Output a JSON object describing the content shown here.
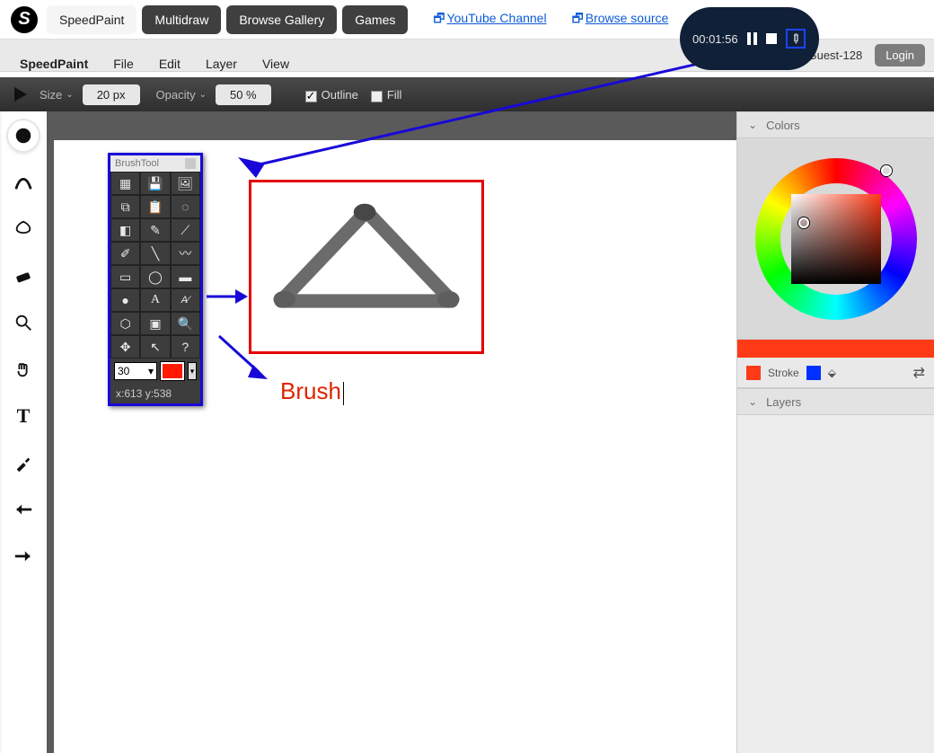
{
  "nav": {
    "logo_letter": "S",
    "tabs": [
      "SpeedPaint",
      "Multidraw",
      "Browse Gallery",
      "Games"
    ],
    "active_tab": 0,
    "links": [
      "YouTube Channel",
      "Browse source"
    ]
  },
  "recorder": {
    "time": "00:01:56"
  },
  "greet": {
    "hello": "Hi Guest-128",
    "login": "Login"
  },
  "menu": {
    "title": "SpeedPaint",
    "items": [
      "File",
      "Edit",
      "Layer",
      "View"
    ]
  },
  "options": {
    "size_label": "Size",
    "size_value": "20 px",
    "opacity_label": "Opacity",
    "opacity_value": "50 %",
    "outline_label": "Outline",
    "outline_checked": true,
    "fill_label": "Fill",
    "fill_checked": false
  },
  "left_tools": [
    "brush",
    "smudge",
    "liquify",
    "eraser",
    "zoom",
    "pan",
    "text",
    "eyedropper",
    "undo",
    "redo"
  ],
  "brushpanel": {
    "title": "BrushTool",
    "size_value": "30",
    "coords": "x:613   y:538",
    "swatch_color": "#ff1a00"
  },
  "canvas_text": "Brush",
  "right": {
    "colors_label": "Colors",
    "stroke_label": "Stroke",
    "layers_label": "Layers",
    "current_color": "#ff3a17",
    "stroke_color": "#0030ff"
  }
}
